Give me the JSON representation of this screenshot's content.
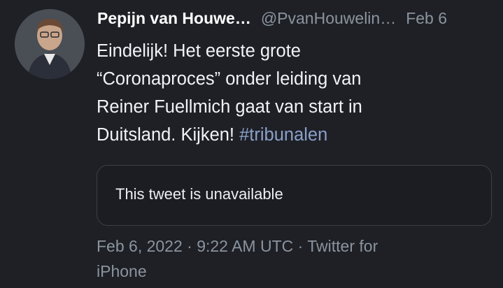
{
  "author": {
    "display_name": "Pepijn van Houwe…",
    "handle": "@PvanHouwelin…",
    "date_short": "Feb 6"
  },
  "tweet": {
    "text_lines": [
      "Eindelijk! Het eerste grote",
      "“Coronaproces” onder leiding van",
      "Reiner Fuellmich gaat van start in",
      "Duitsland. Kijken! "
    ],
    "hashtag": "#tribunalen"
  },
  "quoted_tweet": {
    "text": "This tweet is unavailable"
  },
  "meta": {
    "line1": "Feb 6, 2022 · 9:22 AM UTC · Twitter for",
    "line2": "iPhone"
  },
  "colors": {
    "background": "#1e2026",
    "primary_text": "#f2f3f5",
    "secondary_text": "#8b949e",
    "hashtag": "#8aa0c8",
    "card_border": "#3b3f46"
  }
}
